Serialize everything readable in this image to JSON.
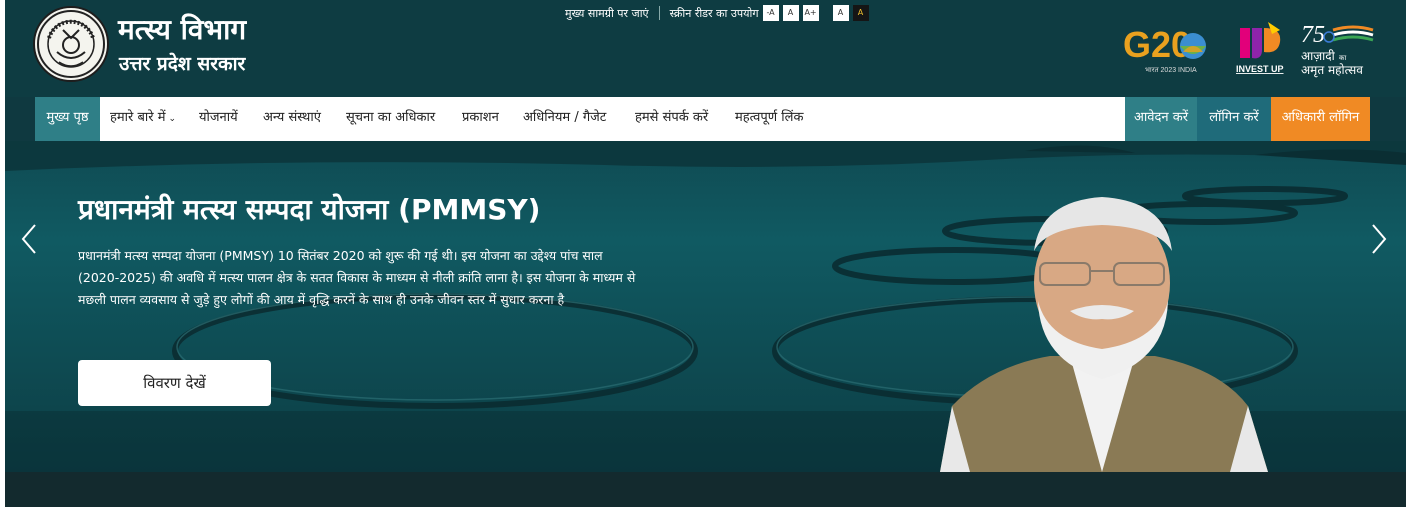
{
  "header": {
    "title": "मत्स्य विभाग",
    "subtitle": "उत्तर प्रदेश सरकार",
    "logo_icon": "up-govt-emblem-icon"
  },
  "accessibility": {
    "skip_link": "मुख्य सामग्री पर जाएं",
    "screen_reader": "स्क्रीन रीडर का उपयोग",
    "font_decrease": "-A",
    "font_normal": "A",
    "font_increase": "A+",
    "theme_light": "A",
    "theme_dark": "A"
  },
  "partner_logos": {
    "g20": {
      "text": "G20",
      "caption": "भारत 2023 INDIA"
    },
    "invest_up": {
      "text": "INVEST UP"
    },
    "azadi": {
      "number": "75",
      "line1": "आज़ादी",
      "small": "का",
      "line2": "अमृत महोत्सव"
    }
  },
  "nav": {
    "home": "मुख्य पृष्ठ",
    "about": "हमारे बारे में",
    "schemes": "योजनायें",
    "other_institutions": "अन्य संस्थाएं",
    "rti": "सूचना का अधिकार",
    "publications": "प्रकाशन",
    "acts_gazette": "अधिनियम / गैजेट",
    "contact": "हमसे संपर्क करें",
    "important_links": "महत्वपूर्ण लिंक",
    "apply": "आवेदन करें",
    "login": "लॉगिन करें",
    "officer_login": "अधिकारी लॉगिन"
  },
  "hero": {
    "title": "प्रधानमंत्री मत्स्य सम्पदा योजना (PMMSY)",
    "description": "प्रधानमंत्री मत्स्य सम्पदा योजना (PMMSY) 10 सितंबर 2020 को शुरू की गई थी। इस योजना का उद्देश्य पांच साल (2020-2025) की अवधि में मत्स्य पालन क्षेत्र के सतत विकास के माध्यम से नीली क्रांति लाना है। इस योजना के माध्यम से मछली पालन व्यवसाय से जुड़े हुए लोगों की आय में वृद्धि करनें के साथ ही उनके जीवन स्तर में सुधार करना है",
    "button": "विवरण देखें"
  },
  "colors": {
    "header_bg": "#0e3c42",
    "nav_home_bg": "#2f7f87",
    "apply_bg": "#2f7f87",
    "login_bg": "#1f6b7a",
    "officer_login_bg": "#f08a24"
  }
}
